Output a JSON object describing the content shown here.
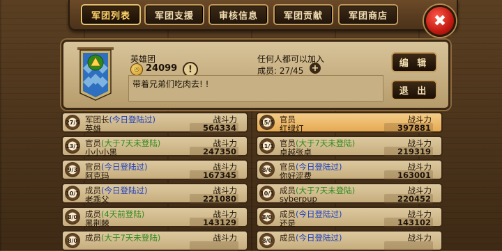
{
  "tabs": [
    {
      "label": "军团列表",
      "active": true
    },
    {
      "label": "军团支援",
      "active": false
    },
    {
      "label": "审核信息",
      "active": false
    },
    {
      "label": "军团贡献",
      "active": false
    },
    {
      "label": "军团商店",
      "active": false
    }
  ],
  "close_label": "✖",
  "guild": {
    "name": "英雄团",
    "gold": "24099",
    "warn_label": "!",
    "join_policy": "任何人都可以加入",
    "members_text": "成员: 27/45",
    "plus_label": "+",
    "motto": "带着兄弟们吃肉去! !",
    "edit_label": "编 辑",
    "exit_label": "退 出"
  },
  "power_label": "战斗力",
  "members": [
    {
      "rank": "27/5",
      "role": "军团长",
      "status": "(今日登陆过)",
      "status_color": "#1d3fbf",
      "name": "英雄",
      "power": "564334",
      "selected": false
    },
    {
      "rank": "15/5",
      "role": "官员",
      "status": "",
      "status_color": "#1d3fbf",
      "name": "红绿灯",
      "power": "397881",
      "selected": true
    },
    {
      "rank": "13/1",
      "role": "官员",
      "status": "(大于7天未登陆)",
      "status_color": "#2d8a1a",
      "name": "小小小黑",
      "power": "247350",
      "selected": false
    },
    {
      "rank": "11/1",
      "role": "官员",
      "status": "(大于7天未登陆)",
      "status_color": "#2d8a1a",
      "name": "卓越张卓",
      "power": "219319",
      "selected": false
    },
    {
      "rank": "9/3",
      "role": "官员",
      "status": "(今日登陆过)",
      "status_color": "#1d3fbf",
      "name": "阿克玛",
      "power": "167345",
      "selected": false
    },
    {
      "rank": "8/6",
      "role": "官员",
      "status": "(今日登陆过)",
      "status_color": "#1d3fbf",
      "name": "你好涩费",
      "power": "163001",
      "selected": false
    },
    {
      "rank": "10/1",
      "role": "成员",
      "status": "(今日登陆过)",
      "status_color": "#1d3fbf",
      "name": "老乖父",
      "power": "221080",
      "selected": false
    },
    {
      "rank": "10/1",
      "role": "成员",
      "status": "(大于7天未登陆)",
      "status_color": "#2d8a1a",
      "name": "syberpup",
      "power": "220452",
      "selected": false
    },
    {
      "rank": "8/0",
      "role": "成员",
      "status": "(4天前登陆)",
      "status_color": "#2d8a1a",
      "name": "黑荆棘",
      "power": "143129",
      "selected": false
    },
    {
      "rank": "8/0",
      "role": "成员",
      "status": "(今日登陆过)",
      "status_color": "#1d3fbf",
      "name": "还是",
      "power": "143102",
      "selected": false
    },
    {
      "rank": "8/0",
      "role": "成员",
      "status": "(大于7天未登陆)",
      "status_color": "#2d8a1a",
      "name": "",
      "power": "",
      "selected": false
    },
    {
      "rank": "8/0",
      "role": "成员",
      "status": "(今日登陆过)",
      "status_color": "#1d3fbf",
      "name": "",
      "power": "",
      "selected": false
    }
  ]
}
